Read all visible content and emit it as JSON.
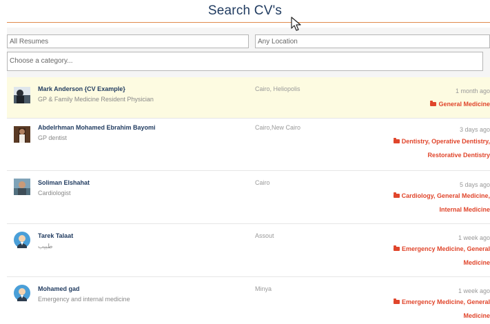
{
  "page": {
    "title": "Search CV's"
  },
  "filters": {
    "keywords_placeholder": "All Resumes",
    "location_placeholder": "Any Location",
    "category_placeholder": "Choose a category..."
  },
  "resumes": [
    {
      "name": "Mark Anderson {CV Example}",
      "role": "GP & Family Medicine Resident Physician",
      "location": "Cairo, Heliopolis",
      "date": "1 month ago",
      "categories": "General Medicine"
    },
    {
      "name": "Abdelrhman Mohamed Ebrahim Bayomi",
      "role": "GP dentist",
      "location": "Cairo,New Cairo",
      "date": "3 days ago",
      "categories": "Dentistry, Operative Dentistry, Restorative Dentistry"
    },
    {
      "name": "Soliman Elshahat",
      "role": "Cardiologist",
      "location": "Cairo",
      "date": "5 days ago",
      "categories": "Cardiology, General Medicine, Internal Medicine"
    },
    {
      "name": "Tarek Talaat",
      "role": "طبيب",
      "location": "Assout",
      "date": "1 week ago",
      "categories": "Emergency Medicine, General Medicine"
    },
    {
      "name": "Mohamed gad",
      "role": "Emergency and internal medicine",
      "location": "Minya",
      "date": "1 week ago",
      "categories": "Emergency Medicine, General Medicine"
    }
  ],
  "colors": {
    "accent": "#e0452b",
    "heading": "#1f3a5f",
    "rule": "#e08a4a",
    "highlight": "#fdfbe1"
  },
  "icons": {
    "category": "folder-icon",
    "cursor": "mouse-pointer-icon"
  }
}
